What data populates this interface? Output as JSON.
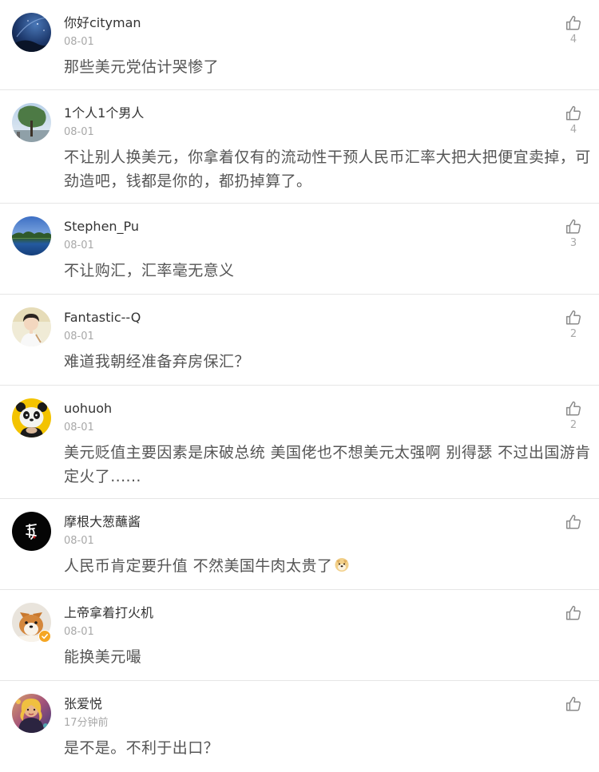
{
  "comments": [
    {
      "name": "你好cityman",
      "time": "08-01",
      "text": "那些美元党估计哭惨了",
      "likes": "4",
      "avatar": "night-sky-avatar",
      "verified": false
    },
    {
      "name": "1个人1个男人",
      "time": "08-01",
      "text": "不让别人换美元，你拿着仅有的流动性干预人民币汇率大把大把便宜卖掉，可劲造吧，钱都是你的，都扔掉算了。",
      "likes": "4",
      "avatar": "tree-sky-avatar",
      "verified": false
    },
    {
      "name": "Stephen_Pu",
      "time": "08-01",
      "text": "不让购汇，汇率毫无意义",
      "likes": "3",
      "avatar": "lake-avatar",
      "verified": false
    },
    {
      "name": "Fantastic--Q",
      "time": "08-01",
      "text": "难道我朝经准备弃房保汇？",
      "likes": "2",
      "avatar": "person-avatar",
      "verified": false
    },
    {
      "name": "uohuoh",
      "time": "08-01",
      "text": "美元贬值主要因素是床破总统 美国佬也不想美元太强啊 别得瑟 不过出国游肯定火了......",
      "likes": "2",
      "avatar": "panda-avatar",
      "verified": false
    },
    {
      "name": "摩根大葱蘸酱",
      "time": "08-01",
      "text": "人民币肯定要升值 不然美国牛肉太贵了",
      "emoji": "doge-emoji",
      "likes": "",
      "avatar": "black-logo-avatar",
      "verified": false
    },
    {
      "name": "上帝拿着打火机",
      "time": "08-01",
      "text": "能换美元嘬",
      "likes": "",
      "avatar": "shiba-avatar",
      "verified": true
    },
    {
      "name": "张爱悦",
      "time": "17分钟前",
      "text": "是不是。不利于出口？",
      "likes": "",
      "avatar": "illustration-avatar",
      "verified": false
    }
  ],
  "icons": {
    "like": "thumbs-up-icon",
    "verified": "verified-badge-icon"
  },
  "colors": {
    "name": "#333333",
    "meta": "#a8a8a8",
    "text": "#555555",
    "divider": "#e6e6e6",
    "verified": "#f5a623"
  }
}
